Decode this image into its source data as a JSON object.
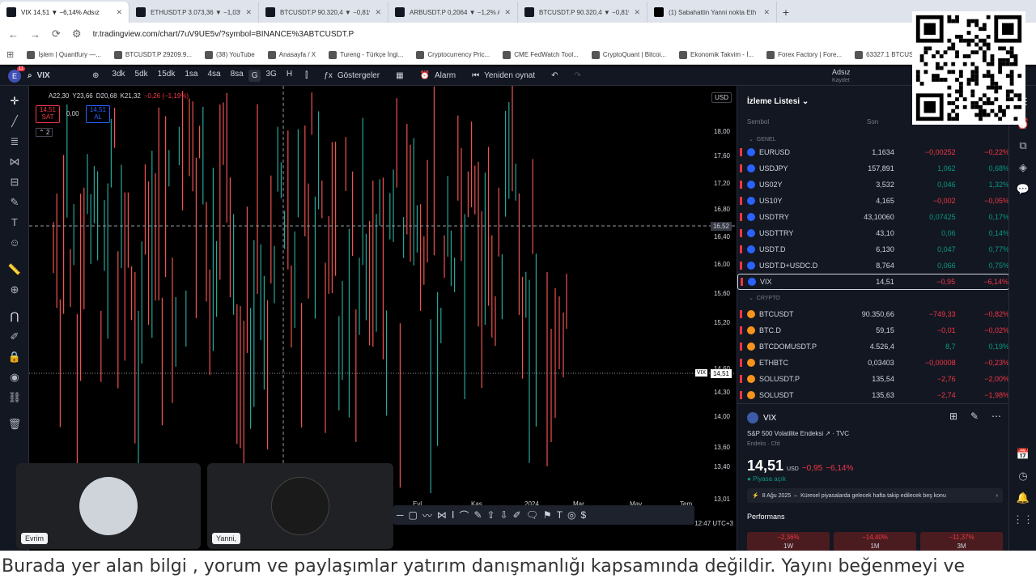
{
  "browser": {
    "tabs": [
      {
        "label": "VIX 14,51 ▼ −6,14% Adsız",
        "active": true
      },
      {
        "label": "ETHUSDT.P 3.073,36 ▼ −1,03%",
        "active": false
      },
      {
        "label": "BTCUSDT.P 90.320,4 ▼ −0,81%",
        "active": false
      },
      {
        "label": "ARBUSDT.P 0,2064 ▼ −1,2% Ad",
        "active": false
      },
      {
        "label": "BTCUSDT.P 90.320,4 ▼ −0,81%",
        "active": false
      },
      {
        "label": "(1) Sabahattin Yanni nokta Eth",
        "active": false
      }
    ],
    "new_tab": "+",
    "url": "tr.tradingview.com/chart/7uV9UE5v/?symbol=BINANCE%3ABTCUSDT.P",
    "bookmarks": [
      "İşlem | Quantfury —...",
      "BTCUSDT.P 29209.9...",
      "(38) YouTube",
      "Anasayfa / X",
      "Tureng - Türkçe İngi...",
      "Cryptocurrency Pric...",
      "CME FedWatch Tool...",
      "CryptoQuant | Bitcoi...",
      "Ekonomik Takvim - İ...",
      "Forex Factory | Fore...",
      "63327.1 BTCUSDT Bi..."
    ]
  },
  "toolbar": {
    "avatar": "E",
    "avatar_badge": "11",
    "symbol": "VIX",
    "intervals": [
      "3dk",
      "5dk",
      "15dk",
      "1sa",
      "4sa",
      "8sa",
      "G",
      "3G",
      "H"
    ],
    "selected_interval": "G",
    "indicators": "Göstergeler",
    "alarm": "Alarm",
    "replay": "Yeniden oynat",
    "layout_name": "Adsız",
    "layout_sub": "Kaydet"
  },
  "chart": {
    "currency": "USD",
    "legend": {
      "a": "A22,30",
      "y": "Y23,66",
      "d": "D20,68",
      "k": "K21,32",
      "chg": "−0,26 (−1,19%)"
    },
    "sell": {
      "price": "14,51",
      "label": "SAT"
    },
    "spread": "0,00",
    "buy": {
      "price": "14,51",
      "label": "AL"
    },
    "layers": "2",
    "price_labels": [
      "18,00",
      "17,60",
      "17,20",
      "16,80",
      "16,40",
      "16,00",
      "15,60",
      "15,20",
      "14,60",
      "14,30",
      "14,00",
      "13,60",
      "13,40",
      "13,01"
    ],
    "crosshair_price": "16,52",
    "last_price": "14,51",
    "last_symbol": "VIX",
    "time_labels": [
      "Eyl",
      "Kas",
      "2024",
      "Mar",
      "May",
      "Tem"
    ],
    "time_readout": "12:47 UTC+3"
  },
  "watchlist": {
    "title": "İzleme Listesi",
    "col_symbol": "Sembol",
    "col_last": "Son",
    "group1": "GENEL",
    "group2": "CRYPTO",
    "rows1": [
      {
        "s": "EURUSD",
        "v1": "1,1634",
        "v2": "−0,00252",
        "v3": "−0,22%",
        "up": false
      },
      {
        "s": "USDJPY",
        "v1": "157,891",
        "v2": "1,062",
        "v3": "0,68%",
        "up": true
      },
      {
        "s": "US02Y",
        "v1": "3,532",
        "v2": "0,046",
        "v3": "1,32%",
        "up": true
      },
      {
        "s": "US10Y",
        "v1": "4,165",
        "v2": "−0,002",
        "v3": "−0,05%",
        "up": false
      },
      {
        "s": "USDTRY",
        "v1": "43,10060",
        "v2": "0,07425",
        "v3": "0,17%",
        "up": true
      },
      {
        "s": "USDTTRY",
        "v1": "43,10",
        "v2": "0,06",
        "v3": "0,14%",
        "up": true
      },
      {
        "s": "USDT.D",
        "v1": "6,130",
        "v2": "0,047",
        "v3": "0,77%",
        "up": true
      },
      {
        "s": "USDT.D+USDC.D",
        "v1": "8,764",
        "v2": "0,066",
        "v3": "0,75%",
        "up": true
      },
      {
        "s": "VIX",
        "v1": "14,51",
        "v2": "−0,95",
        "v3": "−6,14%",
        "up": false
      }
    ],
    "rows2": [
      {
        "s": "BTCUSDT",
        "v1": "90.350,66",
        "v2": "−749,33",
        "v3": "−0,82%",
        "up": false
      },
      {
        "s": "BTC.D",
        "v1": "59,15",
        "v2": "−0,01",
        "v3": "−0,02%",
        "up": false
      },
      {
        "s": "BTCDOMUSDT.P",
        "v1": "4.526,4",
        "v2": "8,7",
        "v3": "0,19%",
        "up": true
      },
      {
        "s": "ETHBTC",
        "v1": "0,03403",
        "v2": "−0,00008",
        "v3": "−0,23%",
        "up": false
      },
      {
        "s": "SOLUSDT.P",
        "v1": "135,54",
        "v2": "−2,76",
        "v3": "−2,00%",
        "up": false
      },
      {
        "s": "SOLUSDT",
        "v1": "135,63",
        "v2": "−2,74",
        "v3": "−1,98%",
        "up": false
      }
    ]
  },
  "details": {
    "symbol": "VIX",
    "desc": "S&P 500 Volatilite Endeksi",
    "exchange": "TVC",
    "type": "Endeks · Cfd",
    "price": "14,51",
    "currency": "USD",
    "change": "−0,95",
    "change_pct": "−6,14%",
    "status": "Piyasa açık",
    "news_date": "8 Ağu 2025",
    "news_text": "Küresel piyasalarda gelecek hafta takip edilecek beş konu",
    "perf_title": "Performans",
    "perf": [
      {
        "v": "−2,36%",
        "l": "1W"
      },
      {
        "v": "−14,40%",
        "l": "1M"
      },
      {
        "v": "−11,37%",
        "l": "3M"
      }
    ]
  },
  "video": {
    "p1": "Evrim",
    "p2": "Yanni,"
  },
  "ticker": "Burada yer alan bilgi , yorum ve paylaşımlar yatırım danışmanlığı kapsamında değildir. Yayını beğenmeyi ve",
  "icons": [
    "back-icon",
    "forward-icon",
    "reload-icon",
    "apps-icon",
    "crosshair-icon",
    "trendline-icon",
    "fib-icon",
    "pattern-icon",
    "brush-icon",
    "text-icon",
    "emoji-icon",
    "ruler-icon",
    "zoom-icon",
    "magnet-icon",
    "lock-icon",
    "eye-icon",
    "trash-icon"
  ]
}
